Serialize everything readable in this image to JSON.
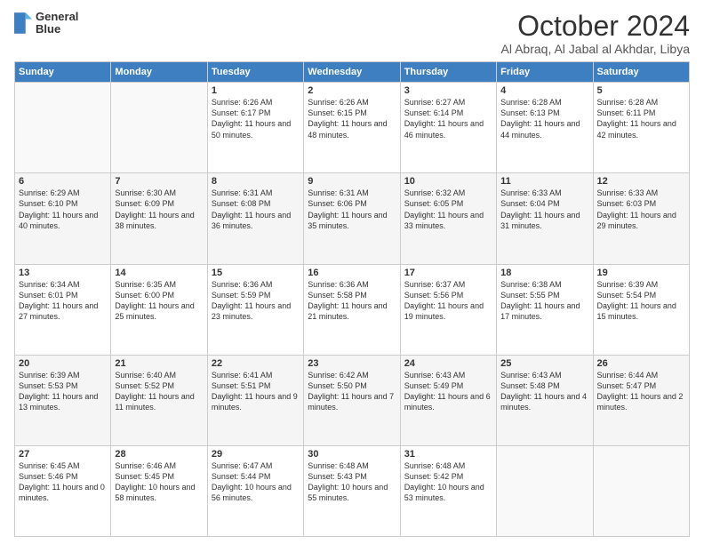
{
  "header": {
    "logo": {
      "line1": "General",
      "line2": "Blue"
    },
    "title": "October 2024",
    "subtitle": "Al Abraq, Al Jabal al Akhdar, Libya"
  },
  "days": [
    "Sunday",
    "Monday",
    "Tuesday",
    "Wednesday",
    "Thursday",
    "Friday",
    "Saturday"
  ],
  "weeks": [
    [
      {
        "day": "",
        "content": ""
      },
      {
        "day": "",
        "content": ""
      },
      {
        "day": "1",
        "content": "Sunrise: 6:26 AM\nSunset: 6:17 PM\nDaylight: 11 hours and 50 minutes."
      },
      {
        "day": "2",
        "content": "Sunrise: 6:26 AM\nSunset: 6:15 PM\nDaylight: 11 hours and 48 minutes."
      },
      {
        "day": "3",
        "content": "Sunrise: 6:27 AM\nSunset: 6:14 PM\nDaylight: 11 hours and 46 minutes."
      },
      {
        "day": "4",
        "content": "Sunrise: 6:28 AM\nSunset: 6:13 PM\nDaylight: 11 hours and 44 minutes."
      },
      {
        "day": "5",
        "content": "Sunrise: 6:28 AM\nSunset: 6:11 PM\nDaylight: 11 hours and 42 minutes."
      }
    ],
    [
      {
        "day": "6",
        "content": "Sunrise: 6:29 AM\nSunset: 6:10 PM\nDaylight: 11 hours and 40 minutes."
      },
      {
        "day": "7",
        "content": "Sunrise: 6:30 AM\nSunset: 6:09 PM\nDaylight: 11 hours and 38 minutes."
      },
      {
        "day": "8",
        "content": "Sunrise: 6:31 AM\nSunset: 6:08 PM\nDaylight: 11 hours and 36 minutes."
      },
      {
        "day": "9",
        "content": "Sunrise: 6:31 AM\nSunset: 6:06 PM\nDaylight: 11 hours and 35 minutes."
      },
      {
        "day": "10",
        "content": "Sunrise: 6:32 AM\nSunset: 6:05 PM\nDaylight: 11 hours and 33 minutes."
      },
      {
        "day": "11",
        "content": "Sunrise: 6:33 AM\nSunset: 6:04 PM\nDaylight: 11 hours and 31 minutes."
      },
      {
        "day": "12",
        "content": "Sunrise: 6:33 AM\nSunset: 6:03 PM\nDaylight: 11 hours and 29 minutes."
      }
    ],
    [
      {
        "day": "13",
        "content": "Sunrise: 6:34 AM\nSunset: 6:01 PM\nDaylight: 11 hours and 27 minutes."
      },
      {
        "day": "14",
        "content": "Sunrise: 6:35 AM\nSunset: 6:00 PM\nDaylight: 11 hours and 25 minutes."
      },
      {
        "day": "15",
        "content": "Sunrise: 6:36 AM\nSunset: 5:59 PM\nDaylight: 11 hours and 23 minutes."
      },
      {
        "day": "16",
        "content": "Sunrise: 6:36 AM\nSunset: 5:58 PM\nDaylight: 11 hours and 21 minutes."
      },
      {
        "day": "17",
        "content": "Sunrise: 6:37 AM\nSunset: 5:56 PM\nDaylight: 11 hours and 19 minutes."
      },
      {
        "day": "18",
        "content": "Sunrise: 6:38 AM\nSunset: 5:55 PM\nDaylight: 11 hours and 17 minutes."
      },
      {
        "day": "19",
        "content": "Sunrise: 6:39 AM\nSunset: 5:54 PM\nDaylight: 11 hours and 15 minutes."
      }
    ],
    [
      {
        "day": "20",
        "content": "Sunrise: 6:39 AM\nSunset: 5:53 PM\nDaylight: 11 hours and 13 minutes."
      },
      {
        "day": "21",
        "content": "Sunrise: 6:40 AM\nSunset: 5:52 PM\nDaylight: 11 hours and 11 minutes."
      },
      {
        "day": "22",
        "content": "Sunrise: 6:41 AM\nSunset: 5:51 PM\nDaylight: 11 hours and 9 minutes."
      },
      {
        "day": "23",
        "content": "Sunrise: 6:42 AM\nSunset: 5:50 PM\nDaylight: 11 hours and 7 minutes."
      },
      {
        "day": "24",
        "content": "Sunrise: 6:43 AM\nSunset: 5:49 PM\nDaylight: 11 hours and 6 minutes."
      },
      {
        "day": "25",
        "content": "Sunrise: 6:43 AM\nSunset: 5:48 PM\nDaylight: 11 hours and 4 minutes."
      },
      {
        "day": "26",
        "content": "Sunrise: 6:44 AM\nSunset: 5:47 PM\nDaylight: 11 hours and 2 minutes."
      }
    ],
    [
      {
        "day": "27",
        "content": "Sunrise: 6:45 AM\nSunset: 5:46 PM\nDaylight: 11 hours and 0 minutes."
      },
      {
        "day": "28",
        "content": "Sunrise: 6:46 AM\nSunset: 5:45 PM\nDaylight: 10 hours and 58 minutes."
      },
      {
        "day": "29",
        "content": "Sunrise: 6:47 AM\nSunset: 5:44 PM\nDaylight: 10 hours and 56 minutes."
      },
      {
        "day": "30",
        "content": "Sunrise: 6:48 AM\nSunset: 5:43 PM\nDaylight: 10 hours and 55 minutes."
      },
      {
        "day": "31",
        "content": "Sunrise: 6:48 AM\nSunset: 5:42 PM\nDaylight: 10 hours and 53 minutes."
      },
      {
        "day": "",
        "content": ""
      },
      {
        "day": "",
        "content": ""
      }
    ]
  ]
}
